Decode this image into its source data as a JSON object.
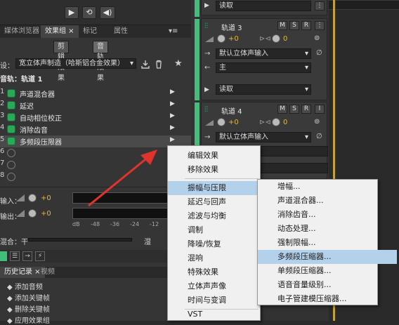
{
  "left": {
    "transport": [
      "▶",
      "⟲",
      "◀)"
    ],
    "tabs": [
      {
        "label": "媒体浏览器",
        "active": false
      },
      {
        "label": "效果组 ×",
        "active": true
      },
      {
        "label": "标记",
        "active": false
      },
      {
        "label": "属性",
        "active": false
      }
    ],
    "panel_menu_icon": "▾≡",
    "subtabs": [
      "剪辑效果",
      "音轨效果"
    ],
    "preset_label": "设：",
    "preset_value": "宽立体声制造（哈斯铝合金效果）",
    "preset_star": "★",
    "track_label": "音轨：轨道 1",
    "effects": [
      {
        "num": "1",
        "name": "声道混合器",
        "on": true
      },
      {
        "num": "2",
        "name": "延迟",
        "on": true
      },
      {
        "num": "3",
        "name": "自动相位校正",
        "on": true
      },
      {
        "num": "4",
        "name": "消除齿音",
        "on": true
      },
      {
        "num": "5",
        "name": "多频段压限器",
        "on": true
      },
      {
        "num": "6",
        "name": "",
        "on": false
      },
      {
        "num": "7",
        "name": "",
        "on": false
      },
      {
        "num": "8",
        "name": "",
        "on": false
      }
    ],
    "input_label": "输入：",
    "output_label": "输出：",
    "gain_value": "+0",
    "meter_ticks": [
      "dB",
      "-48",
      "-36",
      "-24",
      "-12"
    ],
    "mix_label": "混合：干",
    "wet_label": "湿",
    "history_tabs": [
      "历史记录 ×",
      "视频"
    ],
    "history_items": [
      "添加音频",
      "添加关键帧",
      "删除关键帧",
      "应用效果组"
    ]
  },
  "tracks": [
    {
      "name": "",
      "input": "",
      "output": "读取"
    },
    {
      "name": "轨道 3",
      "input": "默认立体声输入",
      "bus": "主",
      "output": "读取",
      "vol": "+0",
      "pan": "0"
    },
    {
      "name": "轨道 4",
      "input": "默认立体声输入",
      "bus": "",
      "output": "",
      "vol": "+0",
      "pan": "0"
    }
  ],
  "track_buttons": [
    "M",
    "S",
    "R",
    "I"
  ],
  "context_menu": {
    "items": [
      "编辑效果",
      "移除效果",
      "振幅与压限",
      "延迟与回声",
      "滤波与均衡",
      "调制",
      "降噪/恢复",
      "混响",
      "特殊效果",
      "立体声声像",
      "时间与变调",
      "VST"
    ],
    "highlighted": "振幅与压限"
  },
  "submenu": {
    "items": [
      "增幅...",
      "声道混合器...",
      "消除齿音...",
      "动态处理...",
      "强制限幅...",
      "多频段压缩器...",
      "单频段压缩器...",
      "语音音量级别...",
      "电子管建模压缩器..."
    ],
    "highlighted": "多频段压缩器..."
  },
  "colors": {
    "accent_green": "#3fbf7a",
    "highlight": "#b4d1eb",
    "arrow_red": "#e0332b"
  }
}
